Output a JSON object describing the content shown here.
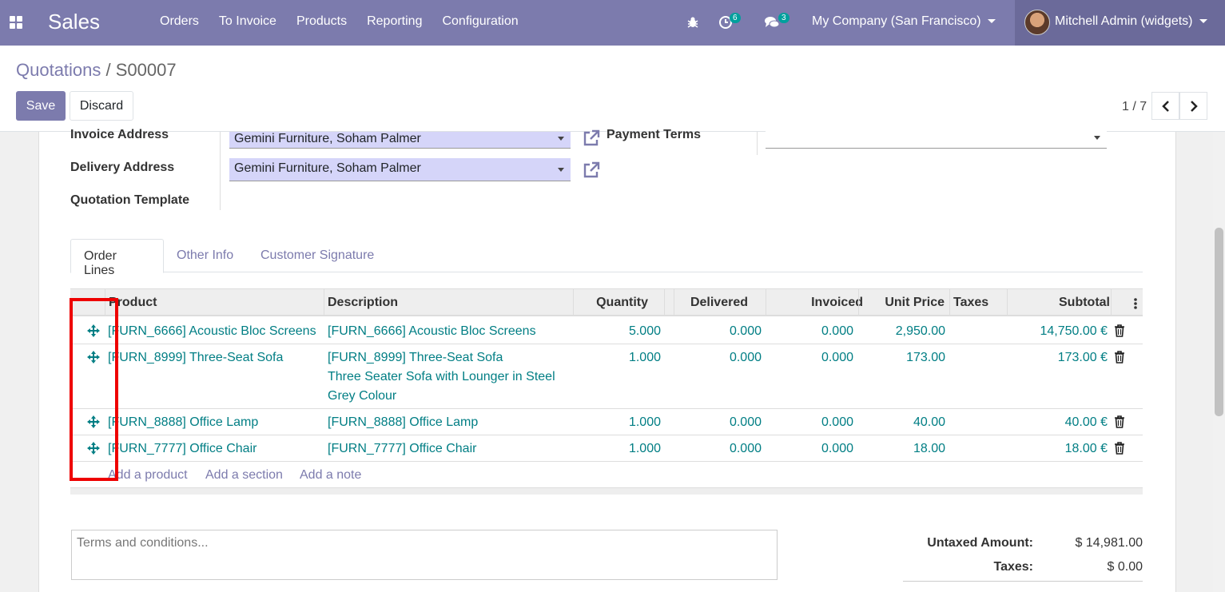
{
  "navbar": {
    "app_name": "Sales",
    "menu": [
      "Orders",
      "To Invoice",
      "Products",
      "Reporting",
      "Configuration"
    ],
    "activity_count": "6",
    "message_count": "3",
    "company": "My Company (San Francisco)",
    "user": "Mitchell Admin (widgets)"
  },
  "breadcrumb": {
    "parent": "Quotations",
    "separator": " / ",
    "current": "S00007"
  },
  "buttons": {
    "save": "Save",
    "discard": "Discard"
  },
  "pager": {
    "value": "1 / 7"
  },
  "form": {
    "invoice_address_label": "Invoice Address",
    "invoice_address_value": "Gemini Furniture, Soham Palmer",
    "delivery_address_label": "Delivery Address",
    "delivery_address_value": "Gemini Furniture, Soham Palmer",
    "quotation_template_label": "Quotation Template",
    "payment_terms_label": "Payment Terms",
    "payment_terms_value": ""
  },
  "tabs": [
    "Order Lines",
    "Other Info",
    "Customer Signature"
  ],
  "table": {
    "headers": [
      "Product",
      "Description",
      "Quantity",
      "Delivered",
      "Invoiced",
      "Unit Price",
      "Taxes",
      "Subtotal"
    ],
    "rows": [
      {
        "product": "[FURN_6666] Acoustic Bloc Screens",
        "description": [
          "[FURN_6666] Acoustic Bloc Screens"
        ],
        "quantity": "5.000",
        "delivered": "0.000",
        "invoiced": "0.000",
        "unit_price": "2,950.00",
        "taxes": "",
        "subtotal": "14,750.00 €"
      },
      {
        "product": "[FURN_8999] Three-Seat Sofa",
        "description": [
          "[FURN_8999] Three-Seat Sofa",
          "Three Seater Sofa with Lounger in Steel",
          "Grey Colour"
        ],
        "quantity": "1.000",
        "delivered": "0.000",
        "invoiced": "0.000",
        "unit_price": "173.00",
        "taxes": "",
        "subtotal": "173.00 €"
      },
      {
        "product": "[FURN_8888] Office Lamp",
        "description": [
          "[FURN_8888] Office Lamp"
        ],
        "quantity": "1.000",
        "delivered": "0.000",
        "invoiced": "0.000",
        "unit_price": "40.00",
        "taxes": "",
        "subtotal": "40.00 €"
      },
      {
        "product": "[FURN_7777] Office Chair",
        "description": [
          "[FURN_7777] Office Chair"
        ],
        "quantity": "1.000",
        "delivered": "0.000",
        "invoiced": "0.000",
        "unit_price": "18.00",
        "taxes": "",
        "subtotal": "18.00 €"
      }
    ],
    "add_links": [
      "Add a product",
      "Add a section",
      "Add a note"
    ]
  },
  "terms_placeholder": "Terms and conditions...",
  "totals": {
    "untaxed_label": "Untaxed Amount:",
    "untaxed_value": "$ 14,981.00",
    "taxes_label": "Taxes:",
    "taxes_value": "$ 0.00"
  },
  "colors": {
    "brand": "#7c7bad",
    "link": "#017e84",
    "highlight": "#ee0000",
    "many2one_bg": "#d5d5f9"
  }
}
